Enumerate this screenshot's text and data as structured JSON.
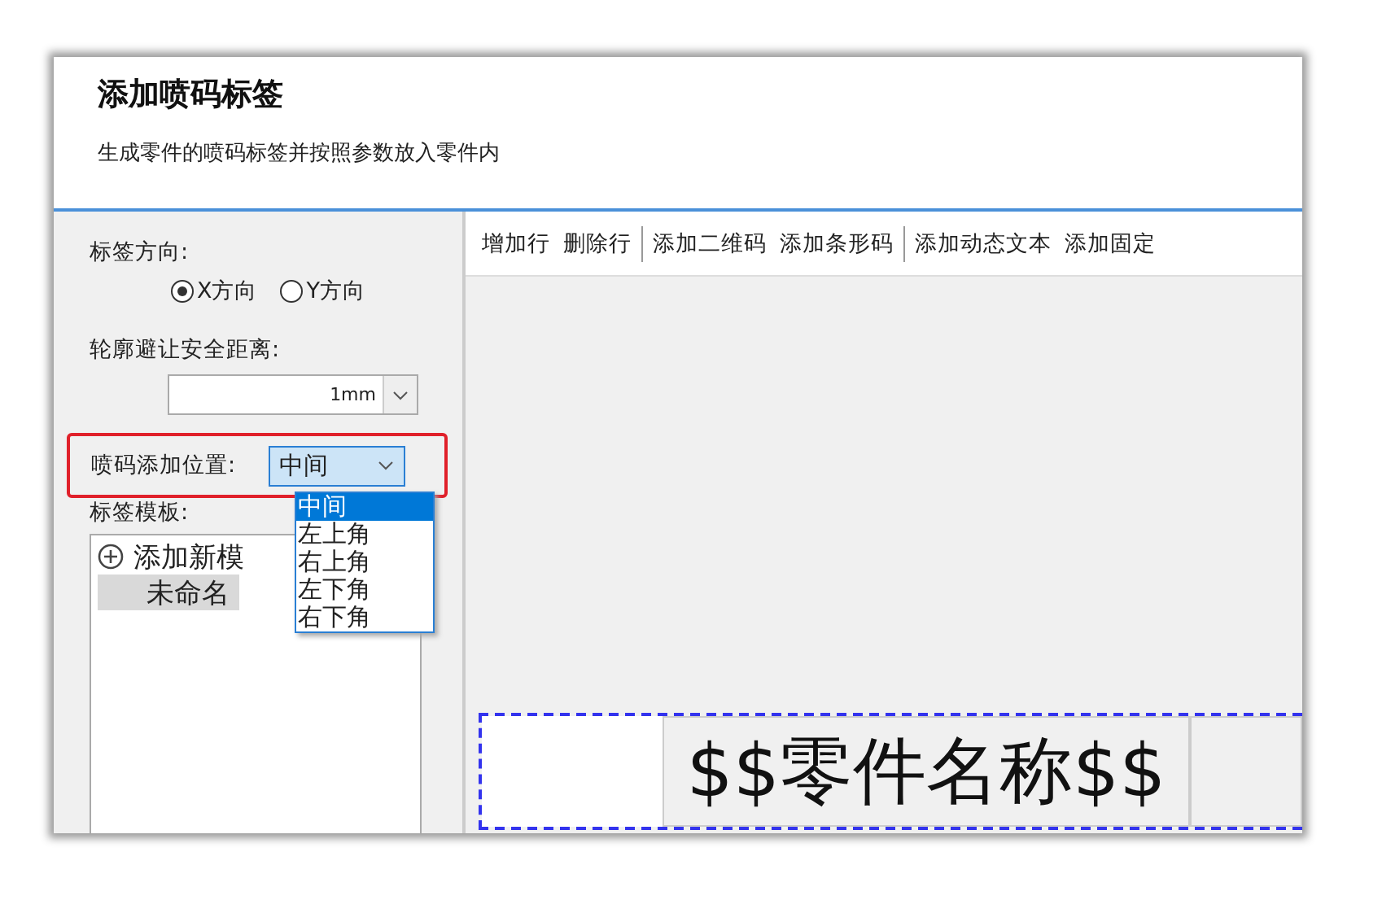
{
  "dialog": {
    "title": "添加喷码标签",
    "subtitle": "生成零件的喷码标签并按照参数放入零件内"
  },
  "left_panel": {
    "orientation": {
      "label": "标签方向:",
      "options": [
        {
          "label": "X方向",
          "selected": true
        },
        {
          "label": "Y方向",
          "selected": false
        }
      ]
    },
    "safe_distance": {
      "label": "轮廓避让安全距离:",
      "value": "1mm"
    },
    "position": {
      "label": "喷码添加位置:",
      "value": "中间",
      "expanded": true,
      "options": [
        {
          "label": "中间",
          "selected": true
        },
        {
          "label": "左上角",
          "selected": false
        },
        {
          "label": "右上角",
          "selected": false
        },
        {
          "label": "左下角",
          "selected": false
        },
        {
          "label": "右下角",
          "selected": false
        }
      ]
    },
    "templates": {
      "label": "标签模板:",
      "items": [
        {
          "kind": "add",
          "label": "添加新模",
          "selected": false
        },
        {
          "kind": "template",
          "label": "未命名",
          "selected": true
        }
      ]
    }
  },
  "toolbar": [
    {
      "buttons": [
        "增加行",
        "删除行"
      ]
    },
    {
      "buttons": [
        "添加二维码",
        "添加条形码"
      ]
    },
    {
      "buttons": [
        "添加动态文本",
        "添加固定"
      ]
    }
  ],
  "preview": {
    "cells": [
      {
        "text": "$$零件名称$$"
      },
      {
        "text": ""
      }
    ]
  }
}
